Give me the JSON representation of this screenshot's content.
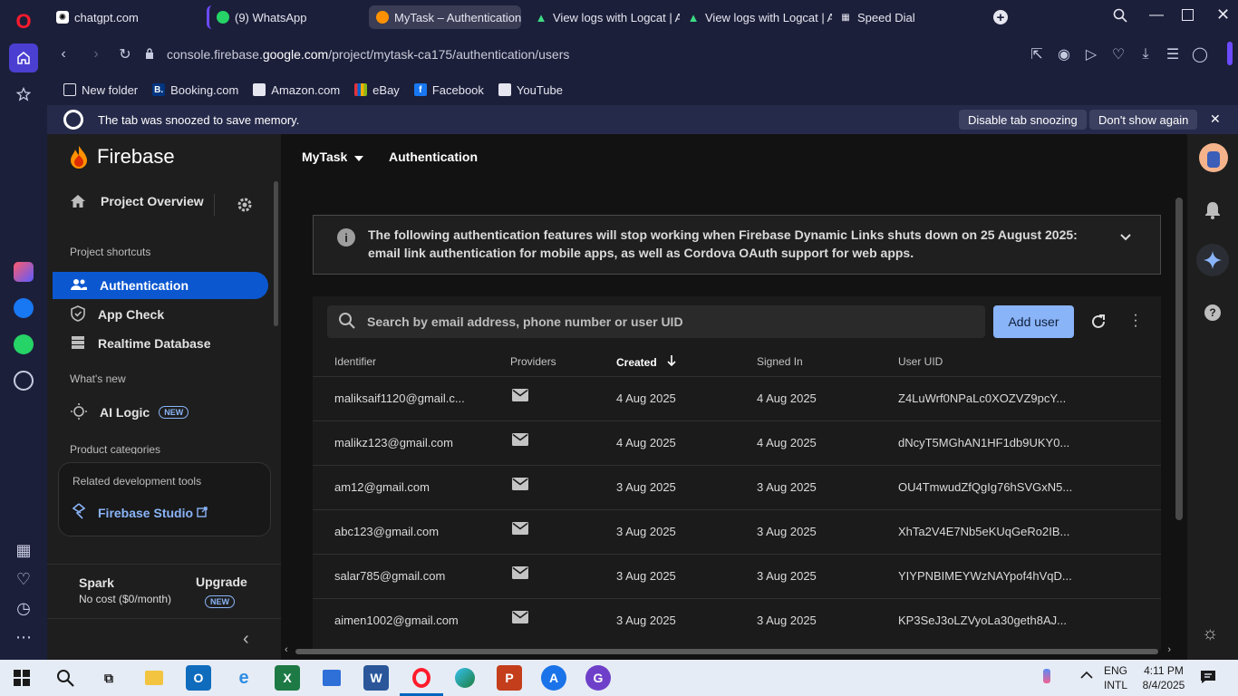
{
  "tabs": [
    {
      "label": "chatgpt.com"
    },
    {
      "label": "(9) WhatsApp"
    },
    {
      "label": "MyTask – Authentication –"
    },
    {
      "label": "View logs with Logcat  |  A"
    },
    {
      "label": "View logs with Logcat  |  A"
    },
    {
      "label": "Speed Dial"
    }
  ],
  "address": {
    "prefix": "console.firebase.",
    "domain": "google.com",
    "path": "/project/mytask-ca175/authentication/users"
  },
  "bookmarks": [
    "New folder",
    "Booking.com",
    "Amazon.com",
    "eBay",
    "Facebook",
    "YouTube"
  ],
  "snooze": {
    "message": "The tab was snoozed to save memory.",
    "disable_label": "Disable tab snoozing",
    "dismiss_label": "Don't show again"
  },
  "firebase": {
    "brand": "Firebase",
    "project": "MyTask",
    "section": "Authentication",
    "project_overview": "Project Overview",
    "shortcuts_heading": "Project shortcuts",
    "nav": [
      {
        "label": "Authentication"
      },
      {
        "label": "App Check"
      },
      {
        "label": "Realtime Database"
      }
    ],
    "whats_new_heading": "What's new",
    "ai_logic": "AI Logic",
    "new_badge": "NEW",
    "product_categories": "Product categories",
    "related_tools_heading": "Related development tools",
    "studio_link": "Firebase Studio",
    "plan_name": "Spark",
    "plan_desc": "No cost ($0/month)",
    "upgrade": "Upgrade",
    "upgrade_badge": "NEW"
  },
  "notice": {
    "text": "The following authentication features will stop working when Firebase Dynamic Links shuts down on 25 August 2025: email link authentication for mobile apps, as well as Cordova OAuth support for web apps."
  },
  "users_table": {
    "search_placeholder": "Search by email address, phone number or user UID",
    "add_user": "Add user",
    "columns": [
      "Identifier",
      "Providers",
      "Created",
      "Signed In",
      "User UID"
    ],
    "rows": [
      {
        "identifier": "maliksaif1120@gmail.c...",
        "created": "4 Aug 2025",
        "signed_in": "4 Aug 2025",
        "uid": "Z4LuWrf0NPaLc0XOZVZ9pcY..."
      },
      {
        "identifier": "malikz123@gmail.com",
        "created": "4 Aug 2025",
        "signed_in": "4 Aug 2025",
        "uid": "dNcyT5MGhAN1HF1db9UKY0..."
      },
      {
        "identifier": "am12@gmail.com",
        "created": "3 Aug 2025",
        "signed_in": "3 Aug 2025",
        "uid": "OU4TmwudZfQgIg76hSVGxN5..."
      },
      {
        "identifier": "abc123@gmail.com",
        "created": "3 Aug 2025",
        "signed_in": "3 Aug 2025",
        "uid": "XhTa2V4E7Nb5eKUqGeRo2IB..."
      },
      {
        "identifier": "salar785@gmail.com",
        "created": "3 Aug 2025",
        "signed_in": "3 Aug 2025",
        "uid": "YIYPNBIMEYWzNAYpof4hVqD..."
      },
      {
        "identifier": "aimen1002@gmail.com",
        "created": "3 Aug 2025",
        "signed_in": "3 Aug 2025",
        "uid": "KP3SeJ3oLZVyoLa30geth8AJ..."
      }
    ]
  },
  "taskbar": {
    "lang_line1": "ENG",
    "lang_line2": "INTL",
    "time": "4:11 PM",
    "date": "8/4/2025"
  },
  "colors": {
    "active_nav": "#0b57d0",
    "add_user_bg": "#8ab4f8",
    "firebase_orange": "#ff9100"
  }
}
